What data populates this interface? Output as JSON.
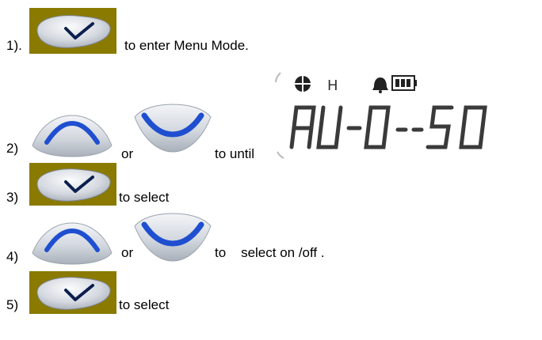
{
  "steps": [
    {
      "number": "1).",
      "text": "to enter Menu Mode."
    },
    {
      "number": "2)",
      "or": "or",
      "text": "to until"
    },
    {
      "number": "3)",
      "text": "to select"
    },
    {
      "number": "4)",
      "or": "or",
      "text": "to    select on /off ."
    },
    {
      "number": "5)",
      "text": "to select"
    }
  ],
  "lcd": {
    "indicator": "H",
    "display_text": "AU-O--5O"
  },
  "icons": {
    "confirm": "check-button-icon",
    "up": "up-arrow-button-icon",
    "down": "down-arrow-button-icon",
    "alarm": "bell-icon",
    "battery": "battery-icon",
    "target": "crosshair-icon"
  },
  "colors": {
    "olive_bg": "#8a7a00",
    "button_silver": "#c9ced6",
    "arc_blue": "#1f4fd0",
    "check_navy": "#0b1f4f"
  }
}
